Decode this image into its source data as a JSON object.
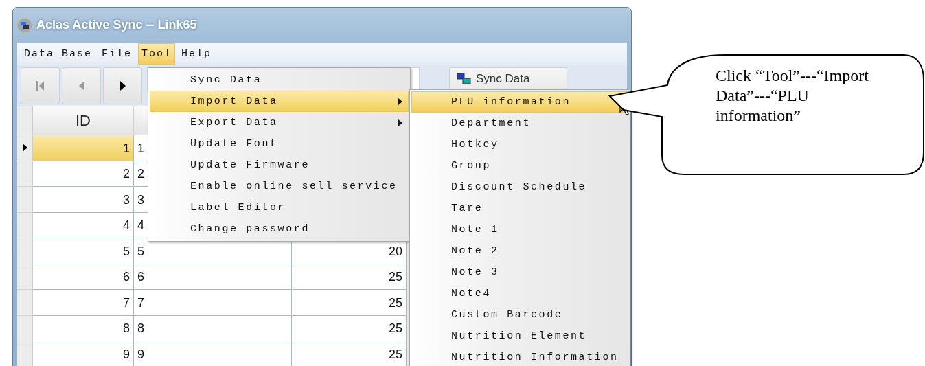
{
  "window": {
    "title": "Aclas Active Sync -- Link65"
  },
  "menubar": [
    {
      "label": "Data Base",
      "selected": false
    },
    {
      "label": "File",
      "selected": false
    },
    {
      "label": "Tool",
      "selected": true
    },
    {
      "label": "Help",
      "selected": false
    }
  ],
  "toolbar": {
    "nav_buttons": [
      {
        "kind": "first",
        "disabled": true
      },
      {
        "kind": "prev",
        "disabled": true
      },
      {
        "kind": "next",
        "disabled": false
      }
    ],
    "sync_button": "Sync Data"
  },
  "grid": {
    "columns": [
      "ID"
    ],
    "rows": [
      {
        "id": "1",
        "column_2": "1",
        "current": true
      },
      {
        "id": "2",
        "column_2": "2",
        "current": false
      },
      {
        "id": "3",
        "column_2": "3",
        "current": false
      },
      {
        "id": "4",
        "column_2": "4",
        "current": false
      },
      {
        "id": "5",
        "column_2": "5",
        "column_3": "20",
        "current": false
      },
      {
        "id": "6",
        "column_2": "6",
        "column_3": "25",
        "current": false
      },
      {
        "id": "7",
        "column_2": "7",
        "column_3": "25",
        "current": false
      },
      {
        "id": "8",
        "column_2": "8",
        "column_3": "25",
        "current": false
      },
      {
        "id": "9",
        "column_2": "9",
        "column_3": "25",
        "current": false
      }
    ]
  },
  "tool_menu": [
    {
      "label": "Sync Data",
      "selected": false,
      "submenu": false
    },
    {
      "label": "Import Data",
      "selected": true,
      "submenu": true
    },
    {
      "label": "Export Data",
      "selected": false,
      "submenu": true
    },
    {
      "label": "Update Font",
      "selected": false,
      "submenu": false
    },
    {
      "label": "Update Firmware",
      "selected": false,
      "submenu": false
    },
    {
      "label": "Enable online sell service",
      "selected": false,
      "submenu": false
    },
    {
      "label": "Label Editor",
      "selected": false,
      "submenu": false
    },
    {
      "label": "Change password",
      "selected": false,
      "submenu": false
    }
  ],
  "import_submenu": [
    {
      "label": "PLU information",
      "selected": true
    },
    {
      "label": "Department",
      "selected": false
    },
    {
      "label": "Hotkey",
      "selected": false
    },
    {
      "label": "Group",
      "selected": false
    },
    {
      "label": "Discount Schedule",
      "selected": false
    },
    {
      "label": "Tare",
      "selected": false
    },
    {
      "label": "Note 1",
      "selected": false
    },
    {
      "label": "Note 2",
      "selected": false
    },
    {
      "label": "Note 3",
      "selected": false
    },
    {
      "label": "Note4",
      "selected": false
    },
    {
      "label": "Custom Barcode",
      "selected": false
    },
    {
      "label": "Nutrition Element",
      "selected": false
    },
    {
      "label": "Nutrition Information",
      "selected": false
    }
  ],
  "callout": {
    "text": "Click “Tool”---“Import Data”---“PLU information”"
  }
}
